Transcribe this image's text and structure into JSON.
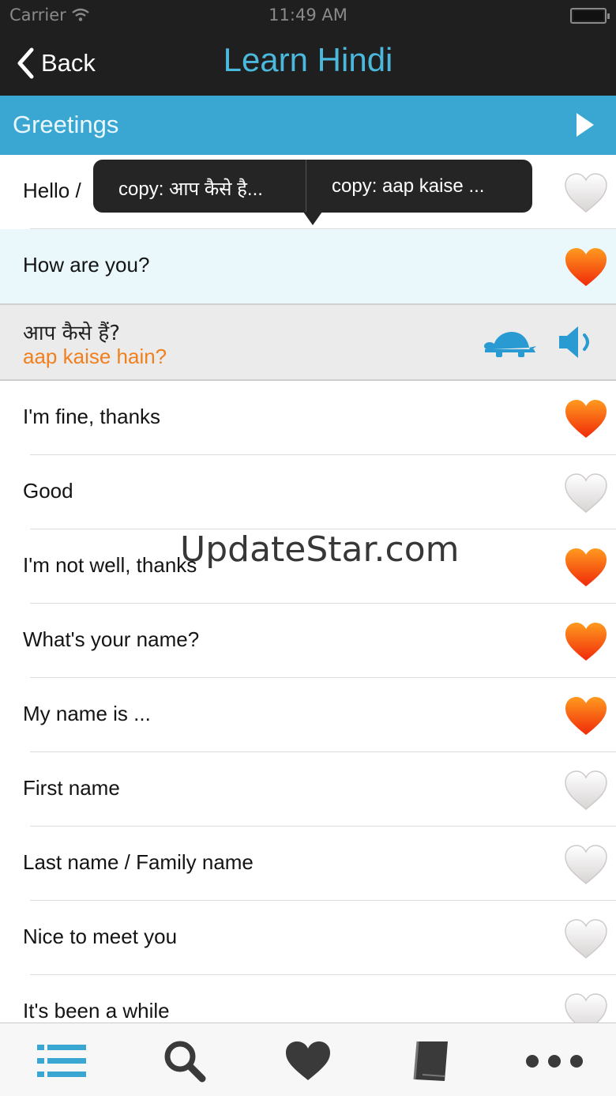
{
  "status_bar": {
    "carrier": "Carrier",
    "time": "11:49 AM"
  },
  "nav": {
    "back_label": "Back",
    "title": "Learn Hindi",
    "title_color": "#4bb8dd"
  },
  "section": {
    "label": "Greetings",
    "color": "#3aa7d2"
  },
  "tooltip": {
    "option1": "copy: आप कैसे है...",
    "option2": "copy: aap kaise ..."
  },
  "phrases": [
    {
      "text": "Hello /",
      "favorite": false
    },
    {
      "text": "How are you?",
      "favorite": true,
      "selected": true
    },
    {
      "text": "I'm fine, thanks",
      "favorite": true
    },
    {
      "text": "Good",
      "favorite": false
    },
    {
      "text": "I'm not well, thanks",
      "favorite": true
    },
    {
      "text": "What's your name?",
      "favorite": true
    },
    {
      "text": "My name is ...",
      "favorite": true
    },
    {
      "text": "First name",
      "favorite": false
    },
    {
      "text": "Last name / Family name",
      "favorite": false
    },
    {
      "text": "Nice to meet you",
      "favorite": false
    },
    {
      "text": "It's been a while",
      "favorite": false
    }
  ],
  "detail": {
    "hindi": "आप कैसे हैं?",
    "romanized": "aap kaise hain?",
    "romanized_color": "#f0801e"
  },
  "watermark": "UpdateStar.com",
  "tabs": [
    {
      "name": "list-icon",
      "active": true
    },
    {
      "name": "search-icon",
      "active": false
    },
    {
      "name": "heart-icon",
      "active": false
    },
    {
      "name": "book-icon",
      "active": false
    },
    {
      "name": "more-icon",
      "active": false
    }
  ]
}
